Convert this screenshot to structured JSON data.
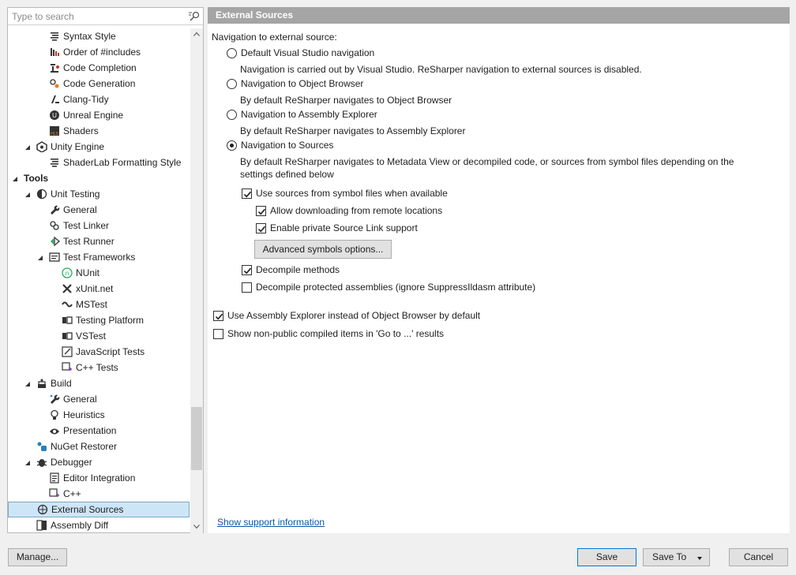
{
  "search": {
    "placeholder": "Type to search",
    "value": ""
  },
  "tree": [
    {
      "label": "Syntax Style",
      "icon": "syntax-style-icon",
      "level": 3,
      "expanded": null,
      "selected": false,
      "bold": false
    },
    {
      "label": "Order of #includes",
      "icon": "order-includes-icon",
      "level": 3,
      "expanded": null,
      "selected": false,
      "bold": false
    },
    {
      "label": "Code Completion",
      "icon": "code-completion-icon",
      "level": 3,
      "expanded": null,
      "selected": false,
      "bold": false
    },
    {
      "label": "Code Generation",
      "icon": "code-generation-icon",
      "level": 3,
      "expanded": null,
      "selected": false,
      "bold": false
    },
    {
      "label": "Clang-Tidy",
      "icon": "clang-tidy-icon",
      "level": 3,
      "expanded": null,
      "selected": false,
      "bold": false
    },
    {
      "label": "Unreal Engine",
      "icon": "unreal-engine-icon",
      "level": 3,
      "expanded": null,
      "selected": false,
      "bold": false
    },
    {
      "label": "Shaders",
      "icon": "shaders-icon",
      "level": 3,
      "expanded": null,
      "selected": false,
      "bold": false
    },
    {
      "label": "Unity Engine",
      "icon": "unity-engine-icon",
      "level": 2,
      "expanded": true,
      "selected": false,
      "bold": false
    },
    {
      "label": "ShaderLab Formatting Style",
      "icon": "shaderlab-icon",
      "level": 3,
      "expanded": null,
      "selected": false,
      "bold": false
    },
    {
      "label": "Tools",
      "icon": "",
      "level": 1,
      "expanded": true,
      "selected": false,
      "bold": true
    },
    {
      "label": "Unit Testing",
      "icon": "unit-testing-icon",
      "level": 2,
      "expanded": true,
      "selected": false,
      "bold": false
    },
    {
      "label": "General",
      "icon": "wrench-icon",
      "level": 3,
      "expanded": null,
      "selected": false,
      "bold": false
    },
    {
      "label": "Test Linker",
      "icon": "test-linker-icon",
      "level": 3,
      "expanded": null,
      "selected": false,
      "bold": false
    },
    {
      "label": "Test Runner",
      "icon": "test-runner-icon",
      "level": 3,
      "expanded": null,
      "selected": false,
      "bold": false
    },
    {
      "label": "Test Frameworks",
      "icon": "test-frameworks-icon",
      "level": 3,
      "expanded": true,
      "selected": false,
      "bold": false
    },
    {
      "label": "NUnit",
      "icon": "nunit-icon",
      "level": 4,
      "expanded": null,
      "selected": false,
      "bold": false
    },
    {
      "label": "xUnit.net",
      "icon": "xunit-icon",
      "level": 4,
      "expanded": null,
      "selected": false,
      "bold": false
    },
    {
      "label": "MSTest",
      "icon": "mstest-icon",
      "level": 4,
      "expanded": null,
      "selected": false,
      "bold": false
    },
    {
      "label": "Testing Platform",
      "icon": "testing-platform-icon",
      "level": 4,
      "expanded": null,
      "selected": false,
      "bold": false
    },
    {
      "label": "VSTest",
      "icon": "vstest-icon",
      "level": 4,
      "expanded": null,
      "selected": false,
      "bold": false
    },
    {
      "label": "JavaScript Tests",
      "icon": "javascript-tests-icon",
      "level": 4,
      "expanded": null,
      "selected": false,
      "bold": false
    },
    {
      "label": "C++ Tests",
      "icon": "cpp-tests-icon",
      "level": 4,
      "expanded": null,
      "selected": false,
      "bold": false
    },
    {
      "label": "Build",
      "icon": "build-icon",
      "level": 2,
      "expanded": true,
      "selected": false,
      "bold": false
    },
    {
      "label": "General",
      "icon": "build-general-icon",
      "level": 3,
      "expanded": null,
      "selected": false,
      "bold": false
    },
    {
      "label": "Heuristics",
      "icon": "lightbulb-icon",
      "level": 3,
      "expanded": null,
      "selected": false,
      "bold": false
    },
    {
      "label": "Presentation",
      "icon": "presentation-icon",
      "level": 3,
      "expanded": null,
      "selected": false,
      "bold": false
    },
    {
      "label": "NuGet Restorer",
      "icon": "nuget-icon",
      "level": 2,
      "expanded": null,
      "selected": false,
      "bold": false
    },
    {
      "label": "Debugger",
      "icon": "bug-icon",
      "level": 2,
      "expanded": true,
      "selected": false,
      "bold": false
    },
    {
      "label": "Editor Integration",
      "icon": "editor-integration-icon",
      "level": 3,
      "expanded": null,
      "selected": false,
      "bold": false
    },
    {
      "label": "C++",
      "icon": "cpp-icon",
      "level": 3,
      "expanded": null,
      "selected": false,
      "bold": false
    },
    {
      "label": "External Sources",
      "icon": "external-sources-icon",
      "level": 2,
      "expanded": null,
      "selected": true,
      "bold": false
    },
    {
      "label": "Assembly Diff",
      "icon": "assembly-diff-icon",
      "level": 2,
      "expanded": null,
      "selected": false,
      "bold": false
    }
  ],
  "panel": {
    "title": "External Sources",
    "nav_label": "Navigation to external source:",
    "radios": [
      {
        "label": "Default Visual Studio navigation",
        "checked": false,
        "desc": "Navigation is carried out by Visual Studio. ReSharper navigation to external sources is disabled."
      },
      {
        "label": "Navigation to Object Browser",
        "checked": false,
        "desc": "By default ReSharper navigates to Object Browser"
      },
      {
        "label": "Navigation to Assembly Explorer",
        "checked": false,
        "desc": "By default ReSharper navigates to Assembly Explorer"
      },
      {
        "label": "Navigation to Sources",
        "checked": true,
        "desc1": "By default ReSharper navigates to Metadata View or decompiled code, or sources from symbol files depending on the",
        "desc2": "settings defined below"
      }
    ],
    "use_symbol_sources": {
      "label": "Use sources from symbol files when available",
      "checked": true
    },
    "allow_remote": {
      "label": "Allow downloading from remote locations",
      "checked": true
    },
    "enable_source_link": {
      "label": "Enable private Source Link support",
      "checked": true
    },
    "advanced_button": "Advanced symbols options...",
    "decompile_methods": {
      "label": "Decompile methods",
      "checked": true
    },
    "decompile_protected": {
      "label": "Decompile protected assemblies (ignore SuppressIldasm attribute)",
      "checked": false
    },
    "use_assembly_explorer": {
      "label": "Use Assembly Explorer instead of Object Browser by default",
      "checked": true
    },
    "show_non_public": {
      "label": "Show non-public compiled items in 'Go to ...' results",
      "checked": false
    },
    "support_link": "Show support information"
  },
  "footer": {
    "manage": "Manage...",
    "save": "Save",
    "save_to": "Save To",
    "cancel": "Cancel"
  }
}
